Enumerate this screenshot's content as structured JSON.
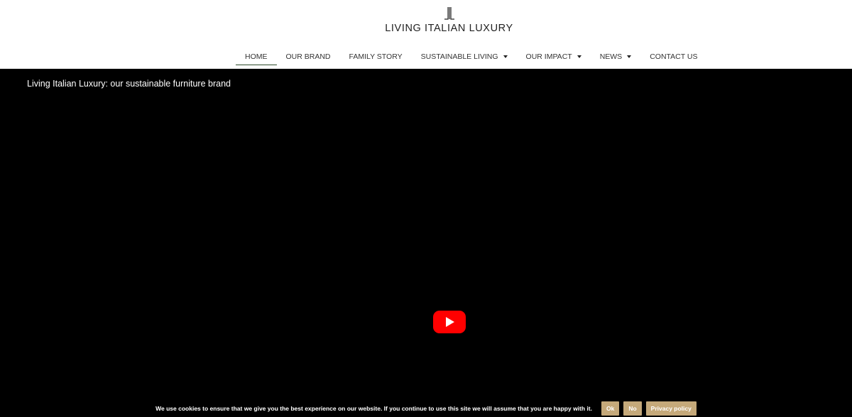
{
  "brand": {
    "name": "LIVING ITALIAN LUXURY",
    "logo_icon": "brand-monogram-icon"
  },
  "nav": {
    "items": [
      {
        "label": "HOME",
        "active": true,
        "has_dropdown": false
      },
      {
        "label": "OUR BRAND",
        "active": false,
        "has_dropdown": false
      },
      {
        "label": "FAMILY STORY",
        "active": false,
        "has_dropdown": false
      },
      {
        "label": "SUSTAINABLE LIVING",
        "active": false,
        "has_dropdown": true
      },
      {
        "label": "OUR IMPACT",
        "active": false,
        "has_dropdown": true
      },
      {
        "label": "NEWS",
        "active": false,
        "has_dropdown": true
      },
      {
        "label": "CONTACT US",
        "active": false,
        "has_dropdown": false
      }
    ],
    "active_underline_color": "#2d4a2a"
  },
  "video": {
    "title": "Living Italian Luxury: our sustainable furniture brand",
    "play_icon": "youtube-play-icon",
    "play_color": "#ff0000"
  },
  "cookie": {
    "text": "We use cookies to ensure that we give you the best experience on our website. If you continue to use this site we will assume that you are happy with it.",
    "ok_label": "Ok",
    "no_label": "No",
    "privacy_label": "Privacy policy",
    "button_color": "#c5a97a"
  }
}
